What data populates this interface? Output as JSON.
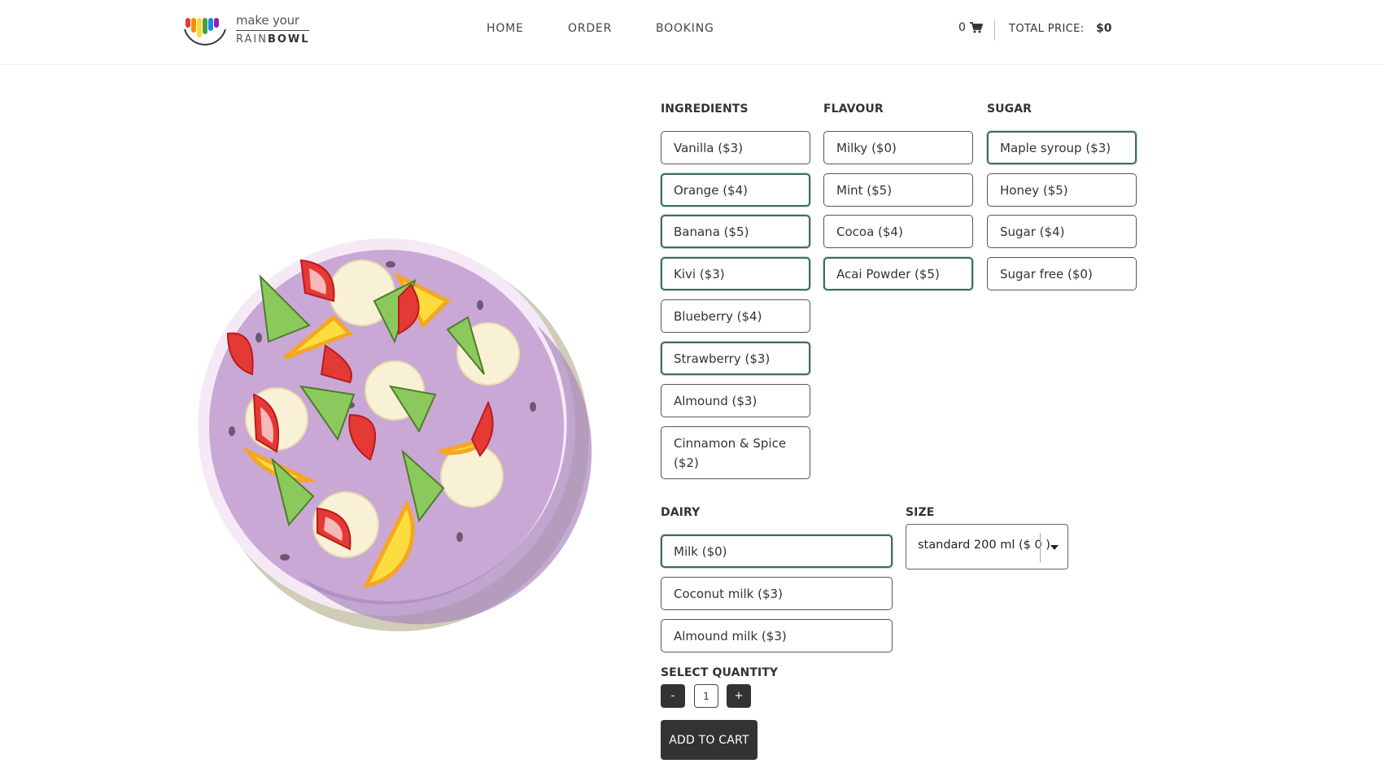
{
  "header": {
    "logo_top": "make your",
    "logo_bottom_light": "RAIN",
    "logo_bottom_bold": "BOWL",
    "nav": [
      "HOME",
      "ORDER",
      "BOOKING"
    ],
    "cart_count": "0",
    "total_label": "TOTAL PRICE:",
    "total_value": "$0",
    "icons": [
      "cart-icon"
    ]
  },
  "sections": {
    "ingredients": {
      "title": "INGREDIENTS",
      "options": [
        {
          "label": "Vanilla ($3)",
          "selected": false
        },
        {
          "label": "Orange ($4)",
          "selected": true
        },
        {
          "label": "Banana ($5)",
          "selected": true
        },
        {
          "label": "Kivi ($3)",
          "selected": true
        },
        {
          "label": "Blueberry ($4)",
          "selected": false
        },
        {
          "label": "Strawberry ($3)",
          "selected": true
        },
        {
          "label": "Almound ($3)",
          "selected": false
        },
        {
          "label": "Cinnamon & Spice ($2)",
          "selected": false
        }
      ]
    },
    "flavour": {
      "title": "FLAVOUR",
      "options": [
        {
          "label": "Milky ($0)",
          "selected": false
        },
        {
          "label": "Mint ($5)",
          "selected": false
        },
        {
          "label": "Cocoa ($4)",
          "selected": false
        },
        {
          "label": "Acai Powder ($5)",
          "selected": true
        }
      ]
    },
    "sugar": {
      "title": "SUGAR",
      "options": [
        {
          "label": "Maple syroup ($3)",
          "selected": true
        },
        {
          "label": "Honey ($5)",
          "selected": false
        },
        {
          "label": "Sugar ($4)",
          "selected": false
        },
        {
          "label": "Sugar free ($0)",
          "selected": false
        }
      ]
    },
    "dairy": {
      "title": "DAIRY",
      "options": [
        {
          "label": "Milk ($0)",
          "selected": true
        },
        {
          "label": "Coconut milk ($3)",
          "selected": false
        },
        {
          "label": "Almound milk ($3)",
          "selected": false
        }
      ]
    },
    "size": {
      "title": "SIZE",
      "selected": "standard 200 ml ($ 0 )"
    }
  },
  "quantity": {
    "title": "SELECT QUANTITY",
    "minus": "-",
    "value": "1",
    "plus": "+"
  },
  "add_to_cart": "ADD TO CART",
  "colors": {
    "selected_border": "#3d6e5c",
    "dark_button": "#333333",
    "bowl_purple": "#c7a7d6"
  }
}
